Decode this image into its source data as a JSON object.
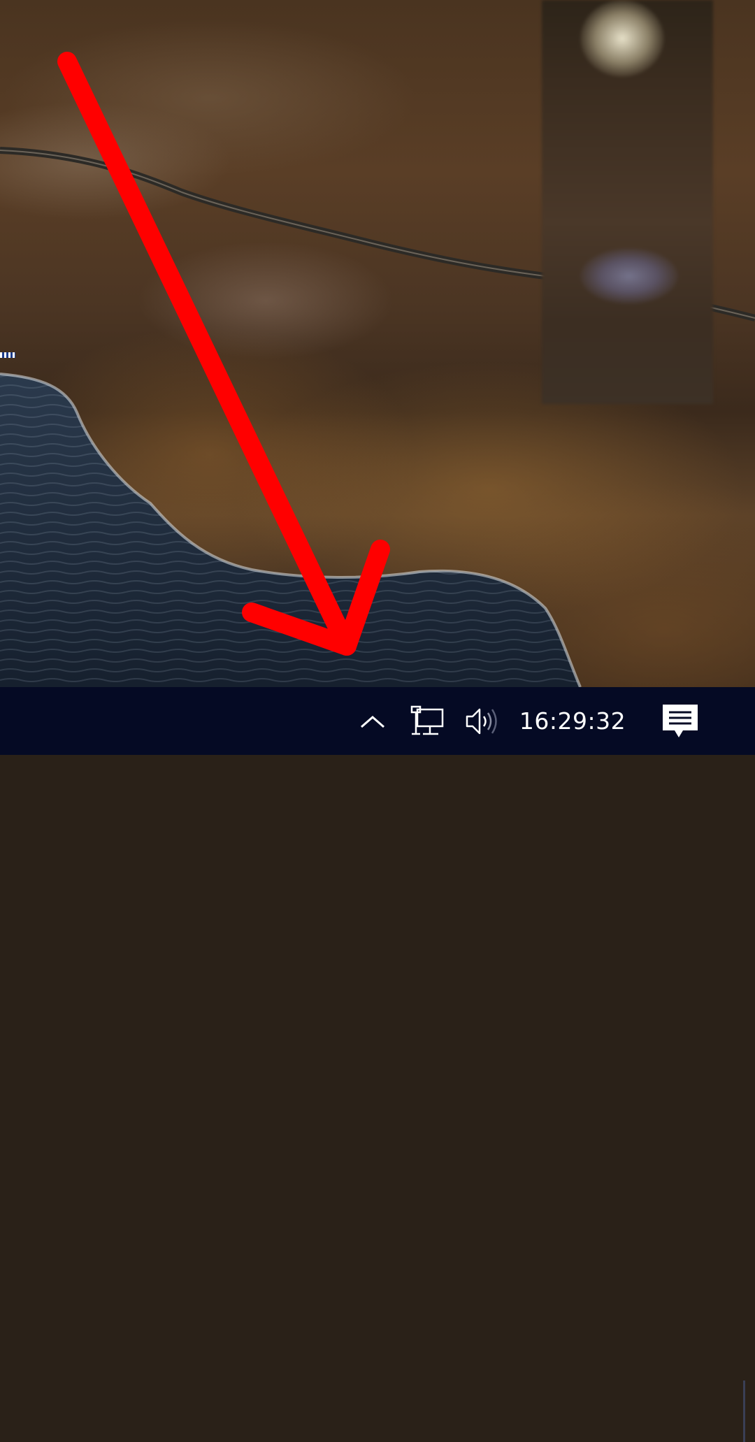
{
  "taskbar": {
    "clock_time": "16:29:32",
    "background_color": "#050a24",
    "icons": {
      "show_hidden": "chevron-up-icon",
      "network": "network-wired-icon",
      "volume": "speaker-icon",
      "notifications": "action-center-icon"
    }
  },
  "overlay": {
    "arrow_color": "#ff0000"
  }
}
